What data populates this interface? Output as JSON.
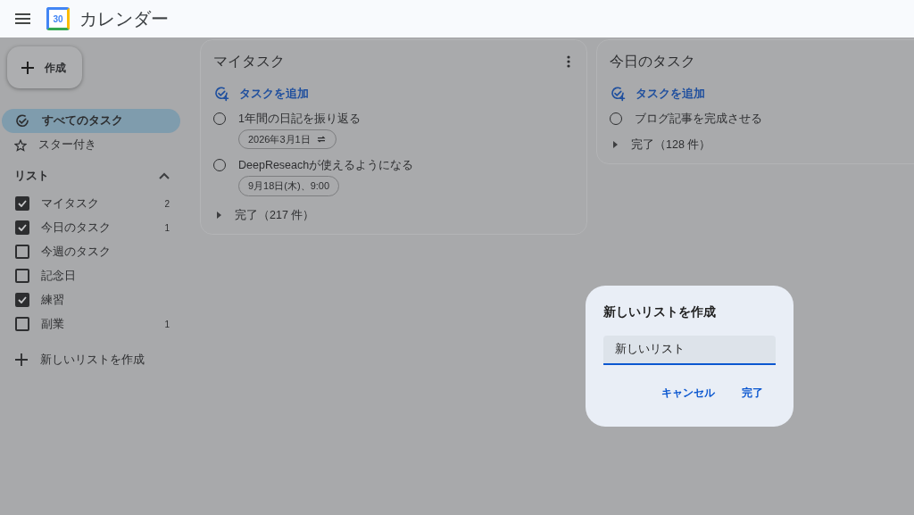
{
  "header": {
    "title": "カレンダー",
    "logo_text": "30"
  },
  "create_button": {
    "label": "作成"
  },
  "nav": [
    {
      "kind": "all",
      "label": "すべてのタスク",
      "selected": true
    },
    {
      "kind": "starred",
      "label": "スター付き",
      "selected": false
    }
  ],
  "lists": {
    "heading": "リスト",
    "expanded": true,
    "items": [
      {
        "name": "マイタスク",
        "checked": true,
        "count": "2"
      },
      {
        "name": "今日のタスク",
        "checked": true,
        "count": "1"
      },
      {
        "name": "今週のタスク",
        "checked": false
      },
      {
        "name": "記念日",
        "checked": false
      },
      {
        "name": "練習",
        "checked": true
      },
      {
        "name": "副業",
        "checked": false,
        "count": "1"
      }
    ],
    "new_list_label": "新しいリストを作成"
  },
  "task_lists": [
    {
      "title": "マイタスク",
      "has_menu": true,
      "add_label": "タスクを追加",
      "tasks": [
        {
          "title": "1年間の日記を振り返る",
          "checked": false,
          "chip": {
            "label": "2026年3月1日",
            "repeat": true
          }
        },
        {
          "title": "DeepReseachが使えるようになる",
          "checked": false,
          "chip": {
            "label": "9月18日(木)、9:00",
            "repeat": false
          }
        }
      ],
      "completed_label": "完了（217 件）"
    },
    {
      "title": "今日のタスク",
      "has_menu": false,
      "add_label": "タスクを追加",
      "tasks": [
        {
          "title": "ブログ記事を完成させる",
          "checked": false
        }
      ],
      "completed_label": "完了（128 件）"
    }
  ],
  "dialog": {
    "title": "新しいリストを作成",
    "input_value": "新しいリスト",
    "buttons": [
      "キャンセル",
      "完了"
    ]
  }
}
